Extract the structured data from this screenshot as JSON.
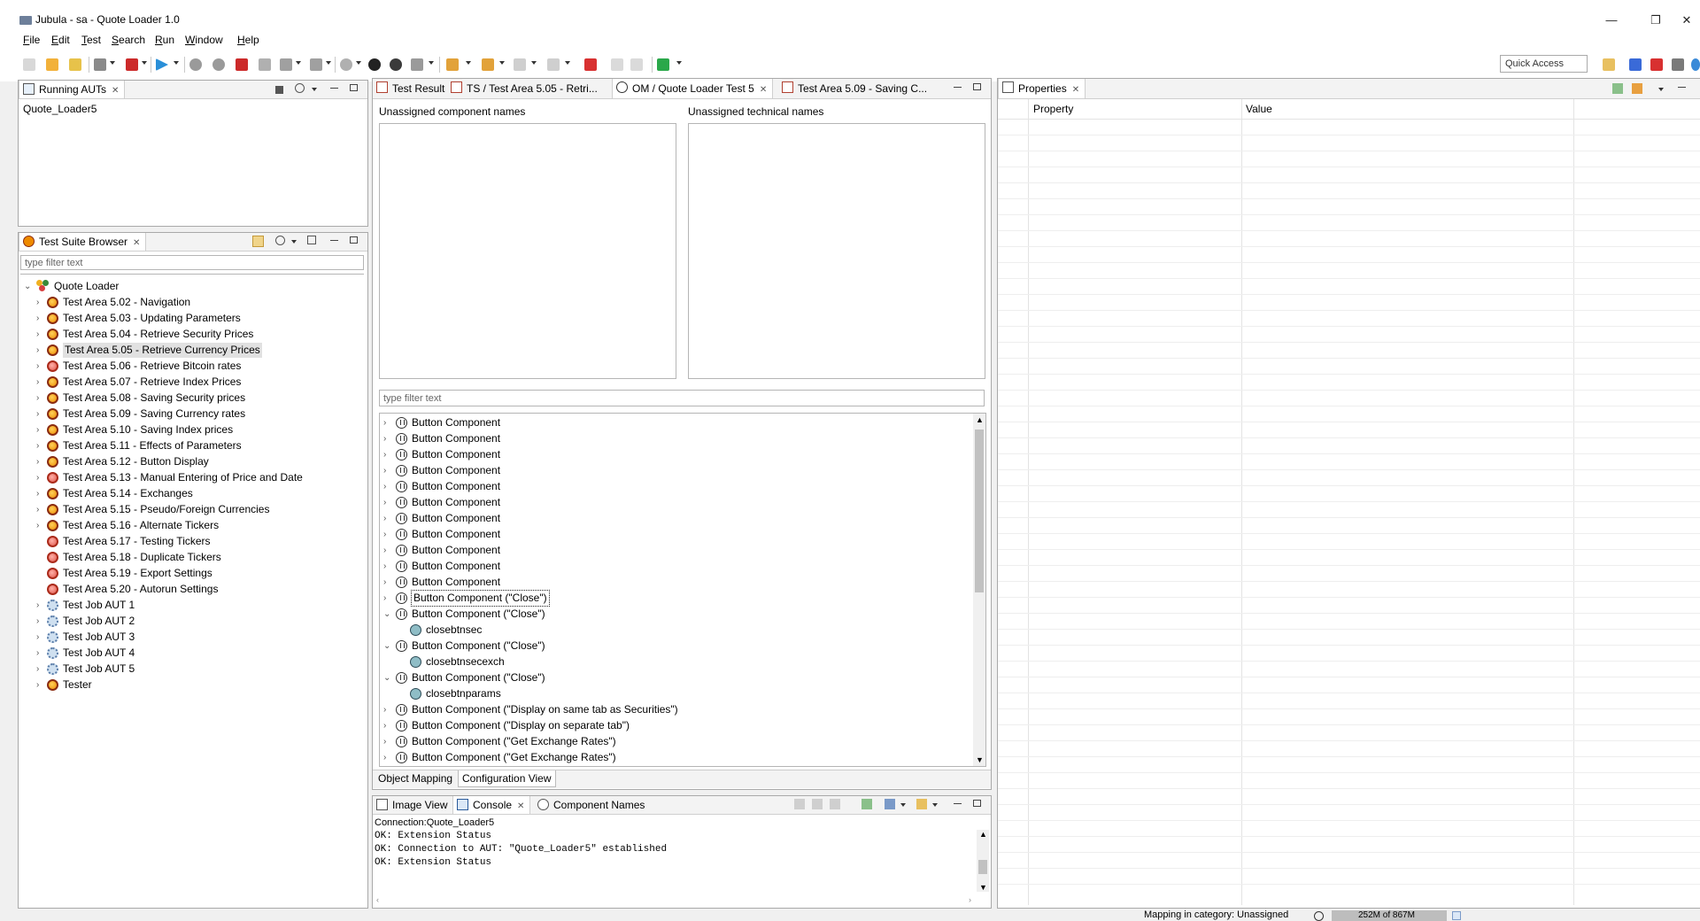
{
  "window": {
    "title": "Jubula - sa - Quote Loader 1.0",
    "controls": {
      "minimize": "—",
      "restore": "❐",
      "close": "✕"
    }
  },
  "menu": [
    "File",
    "Edit",
    "Test",
    "Search",
    "Run",
    "Window",
    "Help"
  ],
  "toolbar": {
    "quick_access": "Quick Access"
  },
  "running_auts": {
    "tab_label": "Running AUTs",
    "items": [
      "Quote_Loader5"
    ]
  },
  "test_suite_browser": {
    "tab_label": "Test Suite Browser",
    "filter_placeholder": "type filter text",
    "root": "Quote Loader",
    "items": [
      {
        "label": "Test Area 5.02 - Navigation",
        "icon": "test-suite-icon",
        "expandable": true
      },
      {
        "label": "Test Area 5.03 - Updating Parameters",
        "icon": "test-suite-icon",
        "expandable": true
      },
      {
        "label": "Test Area 5.04 - Retrieve Security Prices",
        "icon": "test-suite-icon",
        "expandable": true
      },
      {
        "label": "Test Area 5.05 - Retrieve Currency Prices",
        "icon": "test-suite-icon",
        "expandable": true,
        "selected": true
      },
      {
        "label": "Test Area 5.06 - Retrieve Bitcoin rates",
        "icon": "test-suite-warning-icon",
        "expandable": true
      },
      {
        "label": "Test Area 5.07 - Retrieve Index Prices",
        "icon": "test-suite-icon",
        "expandable": true
      },
      {
        "label": "Test Area 5.08 - Saving Security prices",
        "icon": "test-suite-icon",
        "expandable": true
      },
      {
        "label": "Test Area 5.09 - Saving Currency rates",
        "icon": "test-suite-icon",
        "expandable": true
      },
      {
        "label": "Test Area 5.10 - Saving Index prices",
        "icon": "test-suite-icon",
        "expandable": true
      },
      {
        "label": "Test Area 5.11 - Effects of Parameters",
        "icon": "test-suite-icon",
        "expandable": true
      },
      {
        "label": "Test Area 5.12 - Button Display",
        "icon": "test-suite-icon",
        "expandable": true
      },
      {
        "label": "Test Area 5.13 - Manual Entering of Price and Date",
        "icon": "test-suite-warning-icon",
        "expandable": true
      },
      {
        "label": "Test Area 5.14 - Exchanges",
        "icon": "test-suite-icon",
        "expandable": true
      },
      {
        "label": "Test Area 5.15 - Pseudo/Foreign Currencies",
        "icon": "test-suite-icon",
        "expandable": true
      },
      {
        "label": "Test Area 5.16 - Alternate Tickers",
        "icon": "test-suite-icon",
        "expandable": true
      },
      {
        "label": "Test Area 5.17 - Testing Tickers",
        "icon": "test-suite-warning-icon",
        "expandable": false
      },
      {
        "label": "Test Area 5.18 - Duplicate Tickers",
        "icon": "test-suite-warning-icon",
        "expandable": false
      },
      {
        "label": "Test Area 5.19 - Export Settings",
        "icon": "test-suite-warning-icon",
        "expandable": false
      },
      {
        "label": "Test Area 5.20 - Autorun Settings",
        "icon": "test-suite-warning-icon",
        "expandable": false
      },
      {
        "label": "Test Job AUT 1",
        "icon": "test-job-icon",
        "expandable": true
      },
      {
        "label": "Test Job AUT 2",
        "icon": "test-job-icon",
        "expandable": true
      },
      {
        "label": "Test Job AUT 3",
        "icon": "test-job-icon",
        "expandable": true
      },
      {
        "label": "Test Job AUT 4",
        "icon": "test-job-icon",
        "expandable": true
      },
      {
        "label": "Test Job AUT 5",
        "icon": "test-job-icon",
        "expandable": true
      },
      {
        "label": "Tester",
        "icon": "test-suite-icon",
        "expandable": true
      }
    ]
  },
  "editor": {
    "tabs": [
      {
        "label": "Test Result"
      },
      {
        "label": "TS / Test Area 5.05 - Retri..."
      },
      {
        "label": "OM / Quote Loader Test 5",
        "active": true
      },
      {
        "label": "Test Area 5.09 - Saving C..."
      }
    ],
    "unassigned_component_names": "Unassigned component names",
    "unassigned_technical_names": "Unassigned technical names",
    "filter_placeholder": "type filter text",
    "mapping_tree": [
      {
        "label": "Button Component",
        "level": 0,
        "state": "collapsed"
      },
      {
        "label": "Button Component",
        "level": 0,
        "state": "collapsed"
      },
      {
        "label": "Button Component",
        "level": 0,
        "state": "collapsed"
      },
      {
        "label": "Button Component",
        "level": 0,
        "state": "collapsed"
      },
      {
        "label": "Button Component",
        "level": 0,
        "state": "collapsed"
      },
      {
        "label": "Button Component",
        "level": 0,
        "state": "collapsed"
      },
      {
        "label": "Button Component",
        "level": 0,
        "state": "collapsed"
      },
      {
        "label": "Button Component",
        "level": 0,
        "state": "collapsed"
      },
      {
        "label": "Button Component",
        "level": 0,
        "state": "collapsed"
      },
      {
        "label": "Button Component",
        "level": 0,
        "state": "collapsed"
      },
      {
        "label": "Button Component",
        "level": 0,
        "state": "collapsed"
      },
      {
        "label": "Button Component (\"Close\")",
        "level": 0,
        "state": "collapsed",
        "focused": true
      },
      {
        "label": "Button Component (\"Close\")",
        "level": 0,
        "state": "expanded"
      },
      {
        "label": "closebtnsec",
        "level": 1,
        "state": "leaf"
      },
      {
        "label": "Button Component (\"Close\")",
        "level": 0,
        "state": "expanded"
      },
      {
        "label": "closebtnsecexch",
        "level": 1,
        "state": "leaf"
      },
      {
        "label": "Button Component (\"Close\")",
        "level": 0,
        "state": "expanded"
      },
      {
        "label": "closebtnparams",
        "level": 1,
        "state": "leaf"
      },
      {
        "label": "Button Component (\"Display on same tab as Securities\")",
        "level": 0,
        "state": "collapsed"
      },
      {
        "label": "Button Component (\"Display on separate tab\")",
        "level": 0,
        "state": "collapsed"
      },
      {
        "label": "Button Component (\"Get Exchange Rates\")",
        "level": 0,
        "state": "collapsed"
      },
      {
        "label": "Button Component (\"Get Exchange Rates\")",
        "level": 0,
        "state": "collapsed"
      }
    ],
    "bottom_tabs": [
      "Object Mapping",
      "Configuration View"
    ]
  },
  "console_panel": {
    "tabs": [
      {
        "label": "Image View"
      },
      {
        "label": "Console",
        "active": true
      },
      {
        "label": "Component Names"
      }
    ],
    "connection": "Connection:Quote_Loader5",
    "lines": [
      "OK: Extension Status",
      "OK: Connection to AUT: \"Quote_Loader5\" established",
      "OK: Extension Status"
    ]
  },
  "properties": {
    "tab_label": "Properties",
    "col_property": "Property",
    "col_value": "Value"
  },
  "status_bar": {
    "mapping": "Mapping in category: Unassigned",
    "memory": "252M of 867M"
  },
  "colors": {
    "selection": "#e1e1e1",
    "panel_border": "#a9a9a9",
    "tab_bar": "#f3f3f3"
  }
}
